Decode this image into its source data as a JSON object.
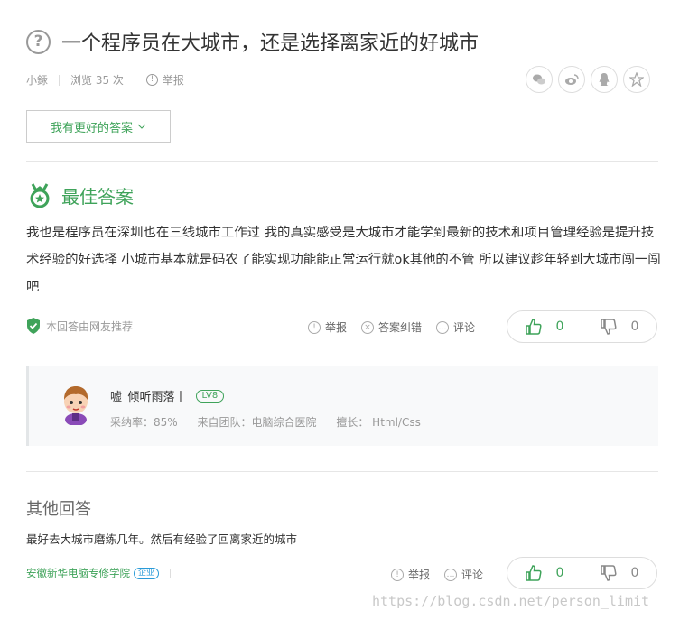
{
  "question": {
    "icon": "question-circle-icon",
    "title": "一个程序员在大城市，还是选择离家近的好城市",
    "author": "小銾",
    "views": "浏览 35 次",
    "report": "举报"
  },
  "share_icons": [
    "wechat-icon",
    "weibo-icon",
    "qq-icon",
    "star-icon"
  ],
  "better_answer_button": "我有更好的答案",
  "best_answer": {
    "title": "最佳答案",
    "text": "我也是程序员在深圳也在三线城市工作过  我的真实感受是大城市才能学到最新的技术和项目管理经验是提升技术经验的好选择 小城市基本就是码农了能实现功能能正常运行就ok其他的不管  所以建议趁年轻到大城市闯一闯吧",
    "recommended": "本回答由网友推荐",
    "report": "举报",
    "correct": "答案纠错",
    "comment": "评论",
    "upvotes": "0",
    "downvotes": "0"
  },
  "answerer": {
    "name": "嘘_倾听雨落丨",
    "level": "LV8",
    "adoption": "采纳率：85%",
    "team": "来自团队：电脑综合医院",
    "expertise": "擅长： Html/Css"
  },
  "other_answers": {
    "title": "其他回答",
    "items": [
      {
        "text": "最好去大城市磨练几年。然后有经验了回离家近的城市",
        "source": "安徽新华电脑专修学院",
        "badge": "企业",
        "report": "举报",
        "comment": "评论",
        "upvotes": "0",
        "downvotes": "0"
      }
    ]
  },
  "watermark": "https://blog.csdn.net/person_limit",
  "colors": {
    "accent": "#3fa35a",
    "muted": "#999999",
    "enterprise": "#2a9bd8"
  }
}
